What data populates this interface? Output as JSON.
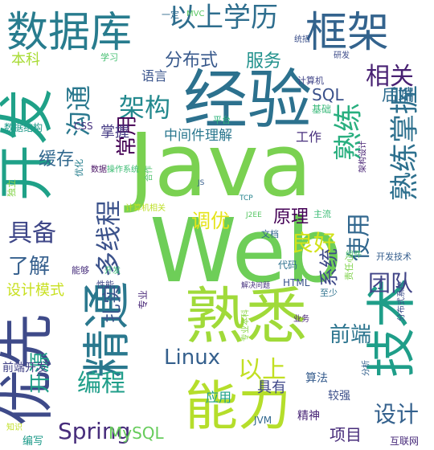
{
  "words": [
    {
      "text": "Java",
      "color": "#7ad151"
    },
    {
      "text": "Web",
      "color": "#6ece58"
    },
    {
      "text": "经验",
      "color": "#2c718e"
    },
    {
      "text": "熟悉",
      "color": "#a0da39"
    },
    {
      "text": "能力",
      "color": "#b5de2b"
    },
    {
      "text": "优先",
      "color": "#3e4a89"
    },
    {
      "text": "开发",
      "color": "#1fa188"
    },
    {
      "text": "技术",
      "color": "#1f9e89"
    },
    {
      "text": "精通",
      "color": "#2a788e"
    },
    {
      "text": "数据库",
      "color": "#287c8e"
    },
    {
      "text": "框架",
      "color": "#33638d"
    },
    {
      "text": "以上学历",
      "color": "#2e6e8e"
    },
    {
      "text": "熟练掌握",
      "color": "#2d708e"
    },
    {
      "text": "熟练",
      "color": "#29af7f"
    },
    {
      "text": "沟通",
      "color": "#2a788e"
    },
    {
      "text": "架构",
      "color": "#23898e"
    },
    {
      "text": "多线程",
      "color": "#3b528b"
    },
    {
      "text": "相关",
      "color": "#482173"
    },
    {
      "text": "使用",
      "color": "#31678e"
    },
    {
      "text": "具备",
      "color": "#3f4788"
    },
    {
      "text": "编程",
      "color": "#1f9e89"
    },
    {
      "text": "设计",
      "color": "#34618d"
    },
    {
      "text": "以上",
      "color": "#c2df23"
    },
    {
      "text": "Linux",
      "color": "#35608d"
    },
    {
      "text": "Spring",
      "color": "#472d7b"
    },
    {
      "text": "团队",
      "color": "#414487"
    },
    {
      "text": "了解",
      "color": "#355f8d"
    },
    {
      "text": "良好",
      "color": "#d2e21b"
    },
    {
      "text": "常用",
      "color": "#440154"
    },
    {
      "text": "开源",
      "color": "#1fa088"
    },
    {
      "text": "分布式",
      "color": "#38598c"
    },
    {
      "text": "服务",
      "color": "#21918c"
    },
    {
      "text": "前端",
      "color": "#2b748e"
    },
    {
      "text": "调优",
      "color": "#e5e419"
    },
    {
      "text": "原理",
      "color": "#440256"
    },
    {
      "text": "缓存",
      "color": "#31688e"
    },
    {
      "text": "项目",
      "color": "#472c7a"
    },
    {
      "text": "扎实",
      "color": "#39558c"
    },
    {
      "text": "系统",
      "color": "#3e4989"
    },
    {
      "text": "SQL",
      "color": "#3b518b"
    },
    {
      "text": "后端",
      "color": "#2f6c8e"
    },
    {
      "text": "MySQL",
      "color": "#67cc5c"
    },
    {
      "text": "设计模式",
      "color": "#c8e020"
    },
    {
      "text": "掌握",
      "color": "#443a83"
    },
    {
      "text": "本科",
      "color": "#a8db34"
    },
    {
      "text": "具有",
      "color": "#3f4889"
    },
    {
      "text": "中间件理解",
      "color": "#2a778e"
    },
    {
      "text": "应用",
      "color": "#1fa187"
    },
    {
      "text": "工作",
      "color": "#472f7d"
    },
    {
      "text": "语言",
      "color": "#3a548c"
    },
    {
      "text": "前端开发",
      "color": "#414287"
    },
    {
      "text": "精神",
      "color": "#482576"
    },
    {
      "text": "算法",
      "color": "#365c8d"
    },
    {
      "text": "较强",
      "color": "#3c4f8a"
    },
    {
      "text": "编写",
      "color": "#1e9b8a"
    },
    {
      "text": "互联网",
      "color": "#472a7a"
    },
    {
      "text": "JVM",
      "color": "#31688e"
    },
    {
      "text": "HTML",
      "color": "#3a538b"
    },
    {
      "text": "代码",
      "color": "#2d708e"
    },
    {
      "text": "CSS",
      "color": "#46307e"
    },
    {
      "text": "数据结构",
      "color": "#1f9a8a"
    },
    {
      "text": "学习",
      "color": "#44bf70"
    },
    {
      "text": "基础",
      "color": "#37b878"
    },
    {
      "text": "平台",
      "color": "#2fb47c"
    },
    {
      "text": "计算机",
      "color": "#404588"
    },
    {
      "text": "研发",
      "color": "#3e4c8a"
    },
    {
      "text": "统招",
      "color": "#3c508b"
    },
    {
      "text": "MVC",
      "color": "#5ac864"
    },
    {
      "text": "一定",
      "color": "#306a8e"
    },
    {
      "text": "优化",
      "color": "#277f8e"
    },
    {
      "text": "独立",
      "color": "#84d44b"
    },
    {
      "text": "数据",
      "color": "#471063"
    },
    {
      "text": "操作系统",
      "color": "#3dbc74"
    },
    {
      "text": "合作",
      "color": "#4ec36b"
    },
    {
      "text": "架构设计",
      "color": "#482374"
    },
    {
      "text": "计算机相关",
      "color": "#bddf26"
    },
    {
      "text": "TCP",
      "color": "#25848e"
    },
    {
      "text": "JS",
      "color": "#365d8d"
    },
    {
      "text": "J2EE",
      "color": "#58c765"
    },
    {
      "text": "主流",
      "color": "#3bbb75"
    },
    {
      "text": "文档",
      "color": "#31668e"
    },
    {
      "text": "组件",
      "color": "#4ac16d"
    },
    {
      "text": "开发技术",
      "color": "#355e8d"
    },
    {
      "text": "能够",
      "color": "#472e7c"
    },
    {
      "text": "开发",
      "color": "#3aba76"
    },
    {
      "text": "性能",
      "color": "#3f4788"
    },
    {
      "text": "责任心",
      "color": "#81d34d"
    },
    {
      "text": "专业",
      "color": "#482677"
    },
    {
      "text": "解决问题",
      "color": "#46327e"
    },
    {
      "text": "至少",
      "color": "#2d718e"
    },
    {
      "text": "专业本科",
      "color": "#8bd646"
    },
    {
      "text": "业务",
      "color": "#482475"
    },
    {
      "text": "分析",
      "color": "#34618d"
    },
    {
      "text": "分布式系统",
      "color": "#3d4e8a"
    },
    {
      "text": "知识",
      "color": "#c0df25"
    }
  ]
}
